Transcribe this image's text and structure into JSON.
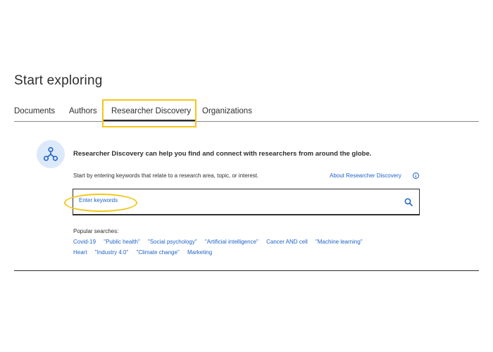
{
  "page": {
    "title": "Start exploring"
  },
  "tabs": [
    {
      "label": "Documents"
    },
    {
      "label": "Authors"
    },
    {
      "label": "Researcher Discovery"
    },
    {
      "label": "Organizations"
    }
  ],
  "active_tab": "Researcher Discovery",
  "panel": {
    "icon": "network-nodes-icon",
    "headline": "Researcher Discovery can help you find and connect with researchers from around the globe.",
    "subline": "Start by entering keywords that relate to a research area, topic, or interest.",
    "about_link": "About Researcher Discovery",
    "search_placeholder": "Enter keywords",
    "popular_label": "Popular searches:",
    "popular_row1": [
      "Covid-19",
      "\"Public health\"",
      "\"Social psychology\"",
      "\"Artificial intelligence\"",
      "Cancer AND cell",
      "\"Machine learning\""
    ],
    "popular_row2": [
      "Heart",
      "\"Industry 4.0\"",
      "\"Climate change\"",
      "Marketing"
    ]
  },
  "colors": {
    "accent": "#1f62c9",
    "highlight": "#f5c518",
    "icon_bg": "#dce9fb",
    "text": "#2e2e2e"
  }
}
